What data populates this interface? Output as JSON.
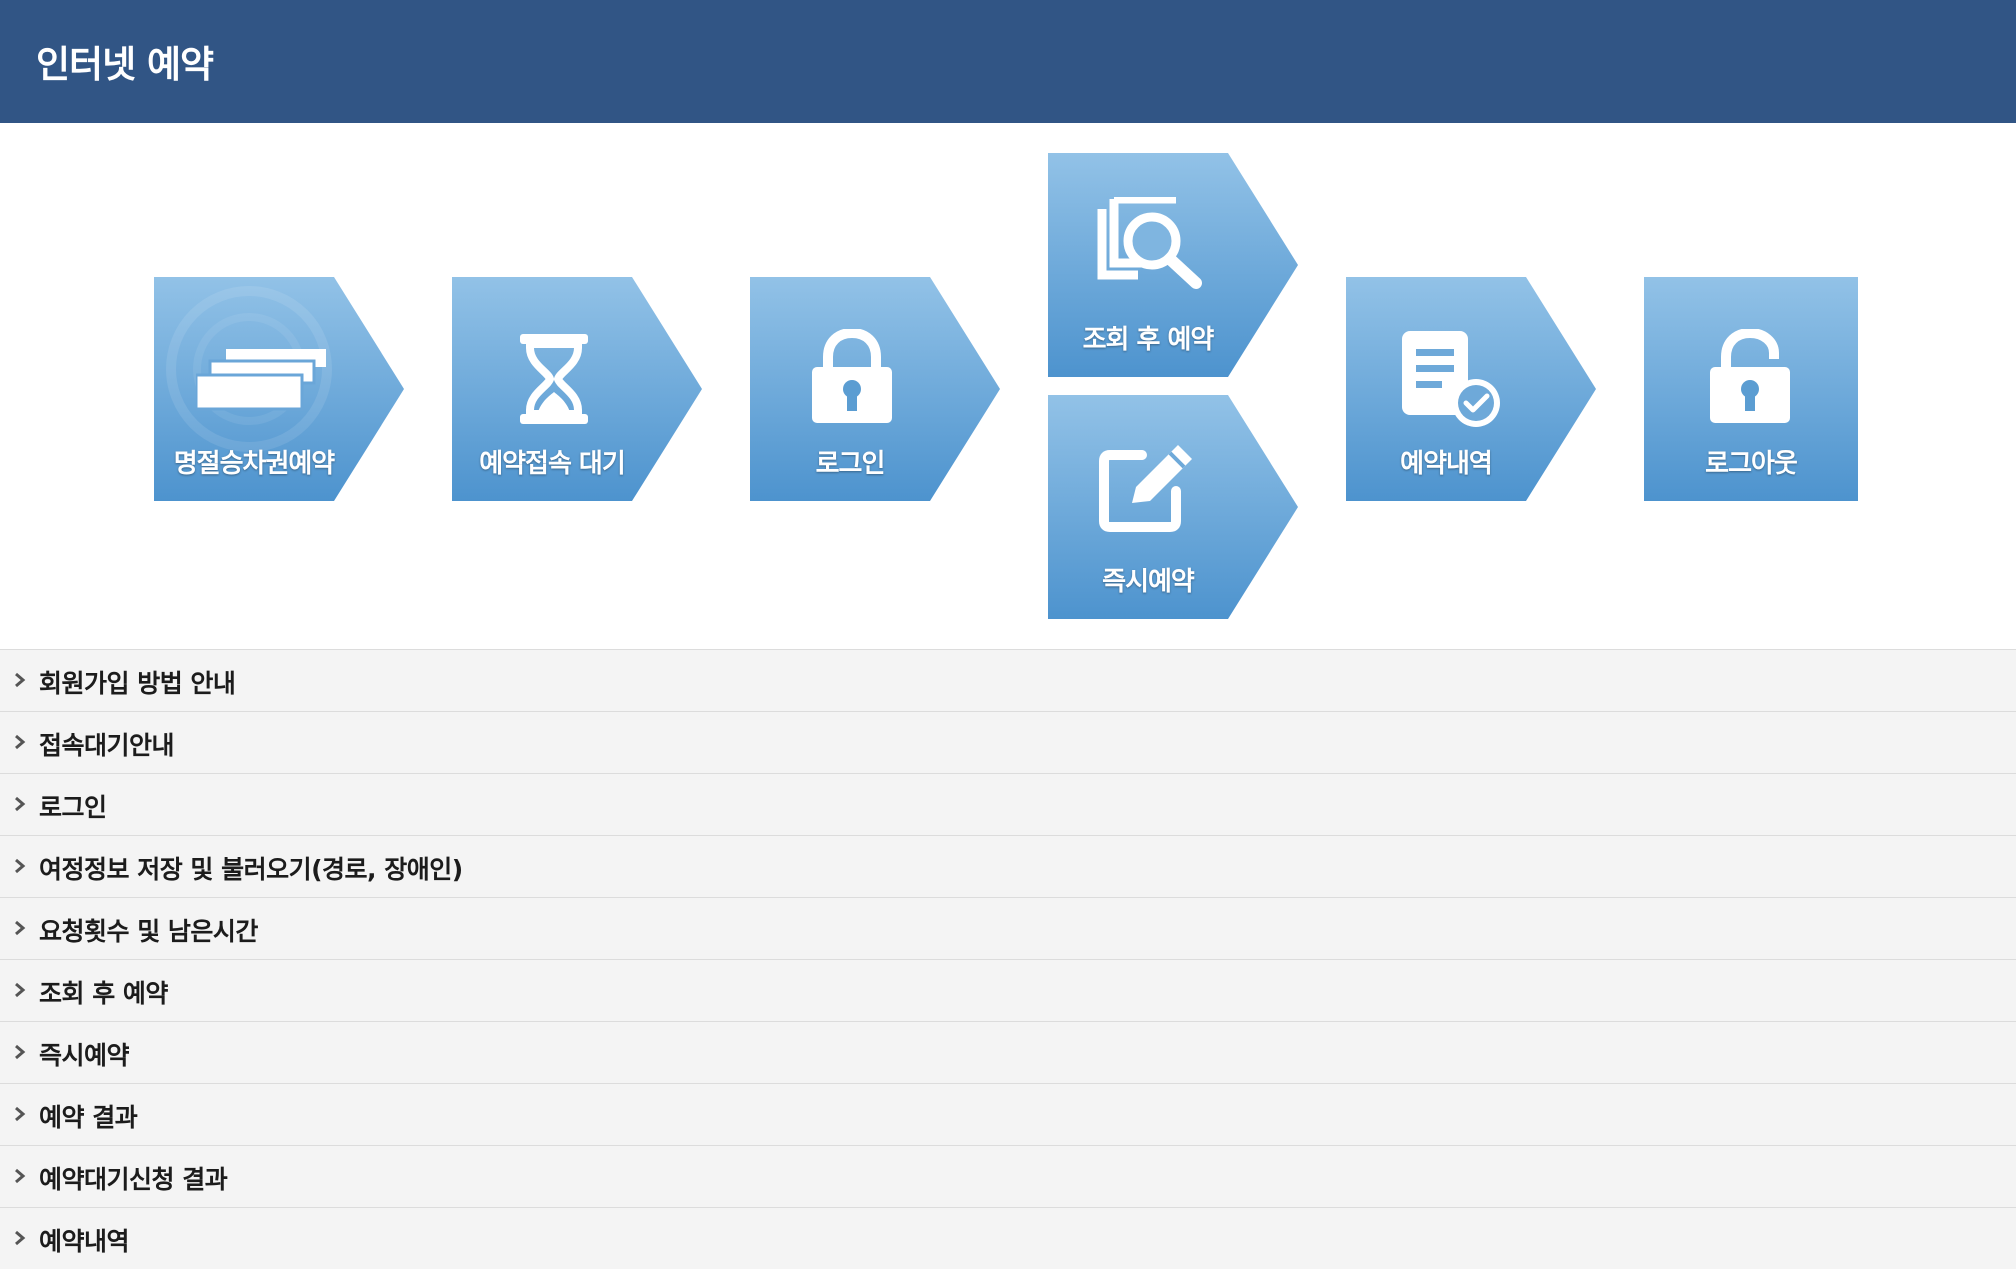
{
  "header": {
    "title": "인터넷 예약"
  },
  "tiles": [
    {
      "label": "명절승차권예약",
      "icon": "ticket-icon"
    },
    {
      "label": "예약접속 대기",
      "icon": "hourglass-icon"
    },
    {
      "label": "로그인",
      "icon": "lock-icon"
    },
    {
      "label": "조회 후 예약",
      "icon": "search-document-icon"
    },
    {
      "label": "즉시예약",
      "icon": "edit-icon"
    },
    {
      "label": "예약내역",
      "icon": "document-check-icon"
    },
    {
      "label": "로그아웃",
      "icon": "unlock-icon"
    }
  ],
  "guide_list": [
    {
      "label": "회원가입 방법 안내"
    },
    {
      "label": "접속대기안내"
    },
    {
      "label": "로그인"
    },
    {
      "label": "여정정보 저장 및 불러오기(경로, 장애인)"
    },
    {
      "label": "요청횟수 및 남은시간"
    },
    {
      "label": "조회 후 예약"
    },
    {
      "label": "즉시예약"
    },
    {
      "label": "예약 결과"
    },
    {
      "label": "예약대기신청 결과"
    },
    {
      "label": "예약내역"
    }
  ],
  "colors": {
    "header_bg": "#315585",
    "tile_light": "#8fc0e6",
    "tile_dark": "#4f95cf",
    "list_bg": "#f4f4f4"
  }
}
